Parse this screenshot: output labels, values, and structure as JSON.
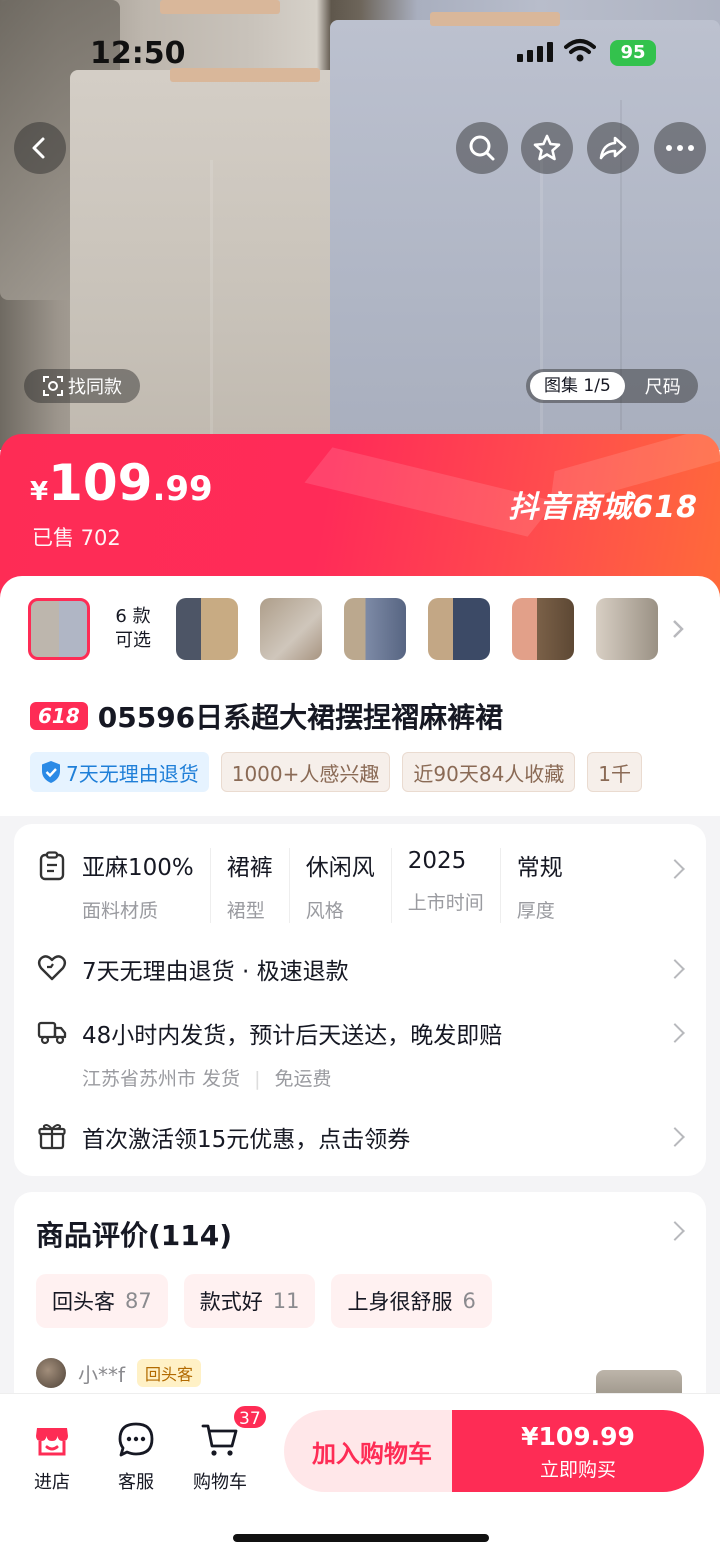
{
  "status_bar": {
    "time": "12:50",
    "battery": "95"
  },
  "hero": {
    "find_similar": "找同款",
    "gallery_label": "图集 1/5",
    "size_label": "尺码"
  },
  "price": {
    "currency": "¥",
    "integer": "109",
    "decimal": ".99",
    "sold": "已售 702"
  },
  "promo": {
    "brand": "抖音商城618",
    "badge": "618"
  },
  "variants": {
    "count_line1": "6 款",
    "count_line2": "可选"
  },
  "product": {
    "title": "05596日系超大裙摆捏褶麻裤裙"
  },
  "tags": [
    "7天无理由退货",
    "1000+人感兴趣",
    "近90天84人收藏",
    "1千"
  ],
  "specs": [
    {
      "value": "亚麻100%",
      "key": "面料材质"
    },
    {
      "value": "裙裤",
      "key": "裙型"
    },
    {
      "value": "休闲风",
      "key": "风格"
    },
    {
      "value": "2025",
      "key": "上市时间"
    },
    {
      "value": "常规",
      "key": "厚度"
    }
  ],
  "service": {
    "returns": "7天无理由退货 · 极速退款",
    "shipping": "48小时内发货，预计后天送达，晚发即赔",
    "shipping_from": "江苏省苏州市 发货",
    "shipping_fee": "免运费",
    "coupon": "首次激活领15元优惠，点击领券"
  },
  "reviews": {
    "title": "商品评价(114)",
    "tags": [
      {
        "label": "回头客",
        "count": "87"
      },
      {
        "label": "款式好",
        "count": "11"
      },
      {
        "label": "上身很舒服",
        "count": "6"
      }
    ],
    "reviewer_name": "小**f",
    "reviewer_badge": "回头客"
  },
  "bottom_bar": {
    "store": "进店",
    "service": "客服",
    "cart": "购物车",
    "cart_count": "37",
    "add_to_cart": "加入购物车",
    "buy_price": "¥109.99",
    "buy_now": "立即购买"
  },
  "colors": {
    "accent": "#fe2c55",
    "banner_end": "#ff6a3a",
    "text": "#161823",
    "muted": "#9a9ba0"
  }
}
